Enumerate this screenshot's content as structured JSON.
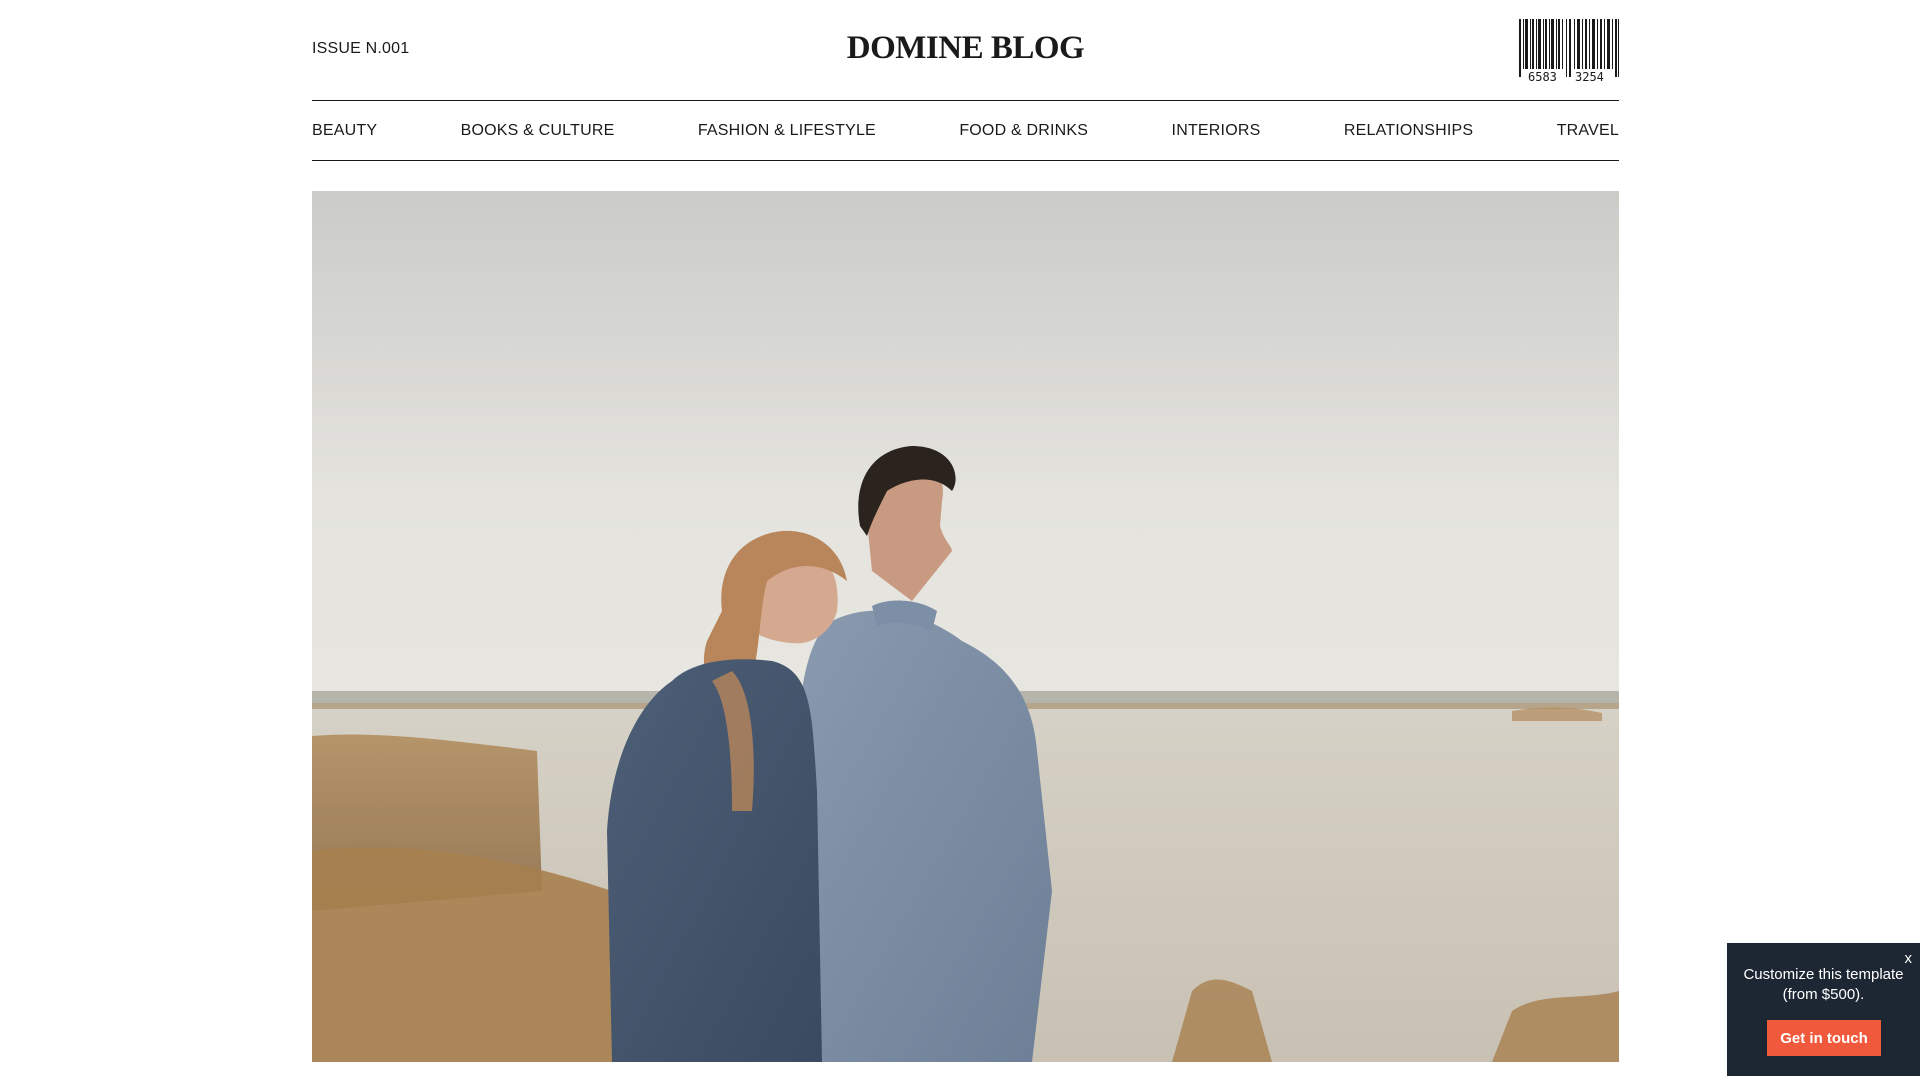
{
  "header": {
    "issue": "ISSUE N.001",
    "title": "DOMINE BLOG",
    "barcode_numbers": [
      "6583",
      "3254"
    ]
  },
  "nav": {
    "items": [
      {
        "label": "BEAUTY"
      },
      {
        "label": "BOOKS & CULTURE"
      },
      {
        "label": "FASHION & LIFESTYLE"
      },
      {
        "label": "FOOD & DRINKS"
      },
      {
        "label": "INTERIORS"
      },
      {
        "label": "RELATIONSHIPS"
      },
      {
        "label": "TRAVEL"
      }
    ]
  },
  "hero": {
    "image_icon": "couple-by-lake-photo"
  },
  "popup": {
    "close_label": "x",
    "text": "Customize this template (from $500).",
    "button_label": "Get in touch",
    "background_color": "#1c2733",
    "button_color": "#f0593c"
  }
}
